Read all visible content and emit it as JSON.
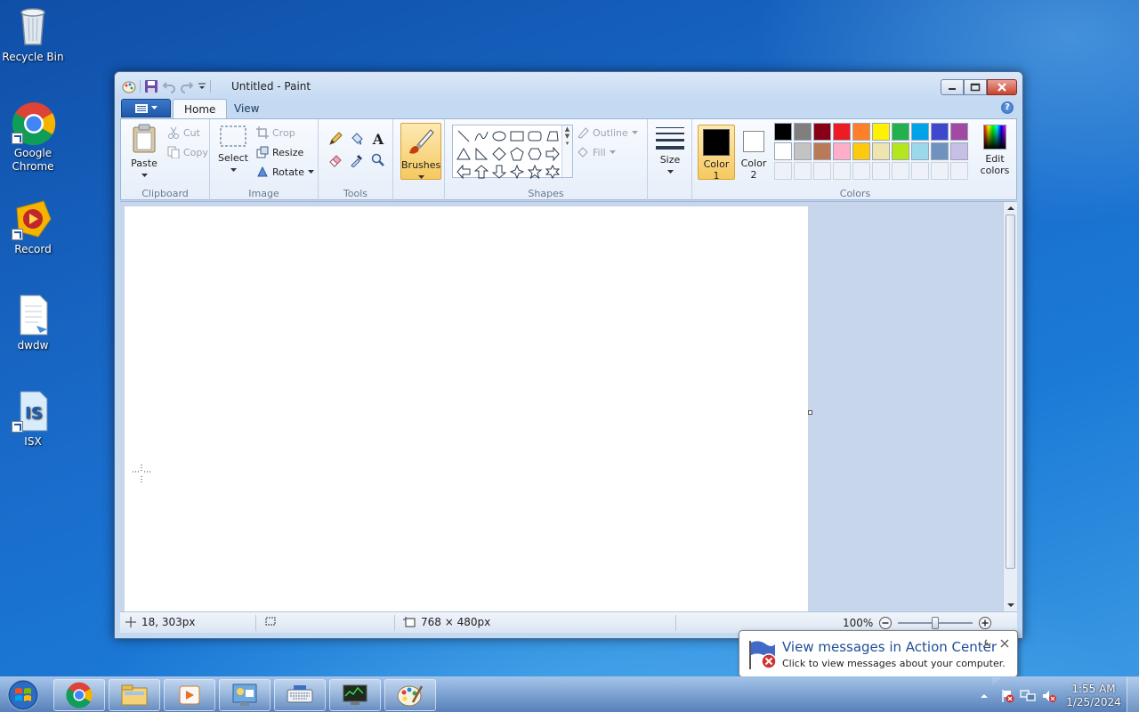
{
  "desktop": {
    "icons": [
      {
        "label": "Recycle Bin"
      },
      {
        "label": "Google Chrome"
      },
      {
        "label": "Record"
      },
      {
        "label": "dwdw"
      },
      {
        "label": "ISX"
      }
    ]
  },
  "window": {
    "title": "Untitled - Paint",
    "tabs": [
      {
        "label": "Home"
      },
      {
        "label": "View"
      }
    ],
    "help": "?"
  },
  "ribbon": {
    "clipboard": {
      "label": "Clipboard",
      "paste": "Paste",
      "cut": "Cut",
      "copy": "Copy"
    },
    "image": {
      "label": "Image",
      "select": "Select",
      "crop": "Crop",
      "resize": "Resize",
      "rotate": "Rotate"
    },
    "tools": {
      "label": "Tools",
      "text_glyph": "A"
    },
    "brushes": {
      "label": "Brushes"
    },
    "shapes": {
      "label": "Shapes",
      "outline": "Outline",
      "fill": "Fill"
    },
    "size": {
      "label": "Size"
    },
    "colors": {
      "label": "Colors",
      "color1_label": "Color",
      "color1_num": "1",
      "color2_label": "Color",
      "color2_num": "2",
      "edit_label": "Edit",
      "edit_label2": "colors",
      "color1": "#000000",
      "color2": "#ffffff",
      "palette_row1": [
        "#000000",
        "#7f7f7f",
        "#880015",
        "#ed1c24",
        "#ff7f27",
        "#fff200",
        "#22b14c",
        "#00a2e8",
        "#3f48cc",
        "#a349a4"
      ],
      "palette_row2": [
        "#ffffff",
        "#c3c3c3",
        "#b97a57",
        "#ffaec9",
        "#ffc90e",
        "#efe4b0",
        "#b5e61d",
        "#99d9ea",
        "#7092be",
        "#c8bfe7"
      ]
    }
  },
  "status": {
    "cursor_pos": "18, 303px",
    "canvas_size": "768 × 480px",
    "zoom": "100%"
  },
  "notification": {
    "title": "View messages in Action Center",
    "text": "Click to view messages about your computer."
  },
  "taskbar": {
    "time": "1:55 AM",
    "date": "1/25/2024"
  }
}
